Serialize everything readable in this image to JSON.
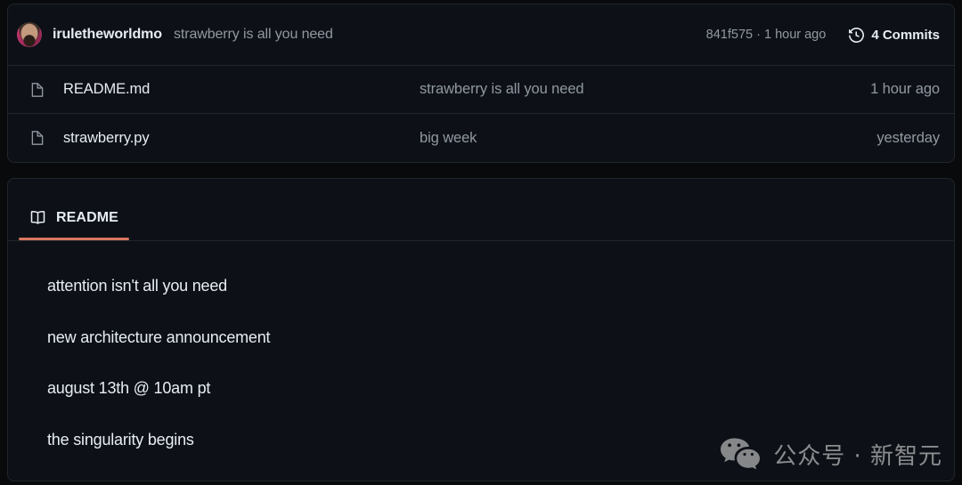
{
  "latest_commit": {
    "avatar_icon": "user-avatar",
    "author": "iruletheworldmo",
    "message": "strawberry is all you need",
    "hash_and_time": "841f575 · 1 hour ago",
    "commits_icon": "history-icon",
    "commits_label": "4 Commits"
  },
  "files": [
    {
      "icon": "file-icon",
      "name": "README.md",
      "commit_message": "strawberry is all you need",
      "updated": "1 hour ago"
    },
    {
      "icon": "file-icon",
      "name": "strawberry.py",
      "commit_message": "big week",
      "updated": "yesterday"
    }
  ],
  "readme": {
    "tab": {
      "icon": "book-icon",
      "label": "README",
      "active": true,
      "accent_color": "#d9775f"
    },
    "lines": [
      "attention isn't all you need",
      "new architecture announcement",
      "august 13th @ 10am pt",
      "the singularity begins"
    ]
  },
  "watermark": {
    "icon": "wechat-icon",
    "text": "公众号 · 新智元"
  },
  "colors": {
    "page_background": "#090a0c",
    "card_background": "#0d1117",
    "border": "#21262d",
    "text_primary": "#e6edf3",
    "text_muted": "#9198a1",
    "accent": "#d9775f"
  }
}
